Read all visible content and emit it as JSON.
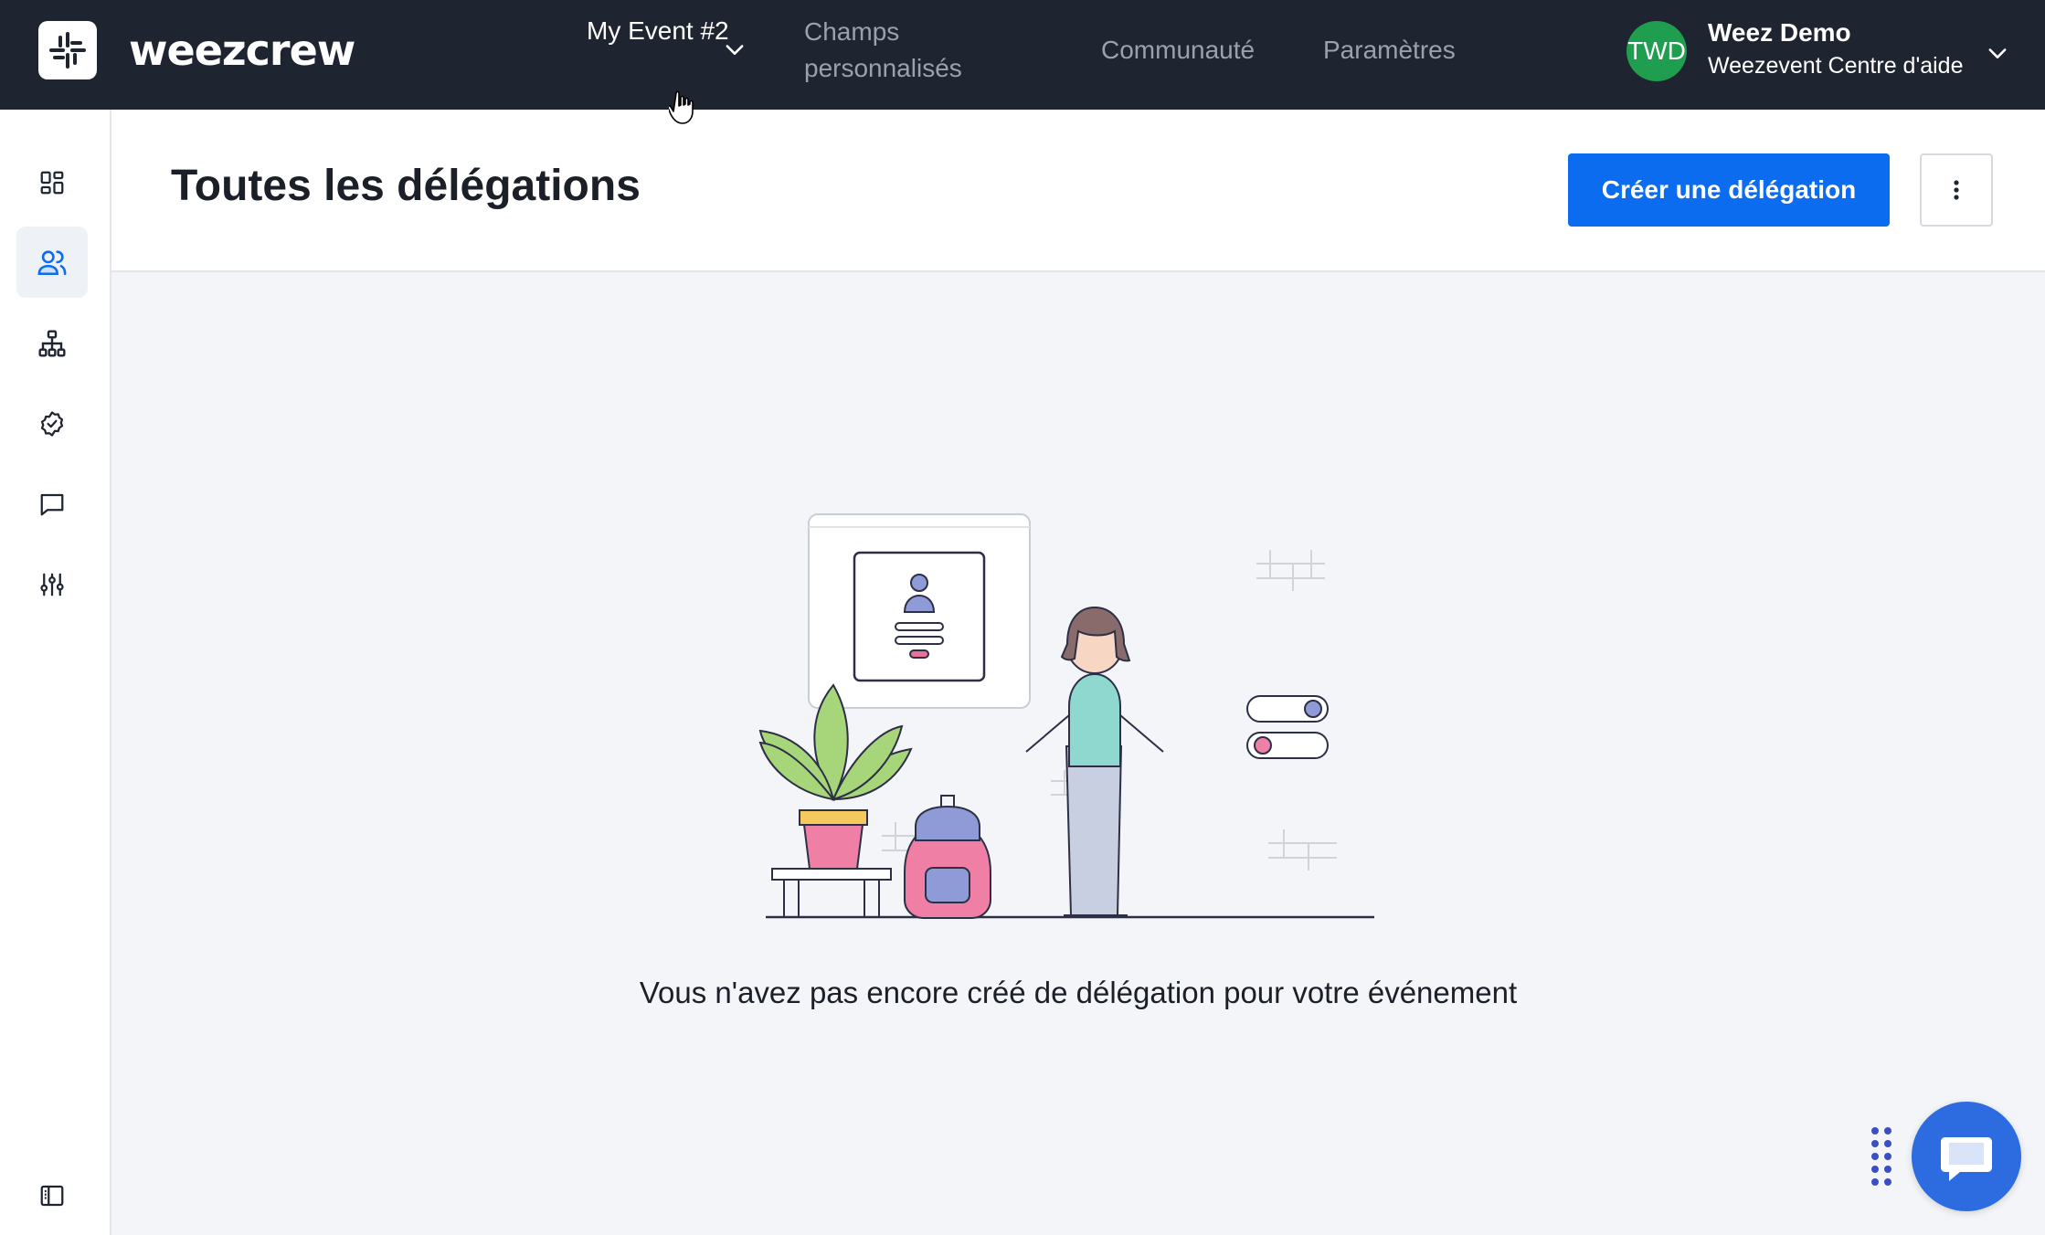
{
  "app": {
    "brand": "weezcrew"
  },
  "topbar": {
    "event_select": {
      "label": "My Event #2"
    },
    "nav": [
      {
        "label": "Champs personnalisés"
      },
      {
        "label": "Communauté"
      },
      {
        "label": "Paramètres"
      }
    ],
    "user": {
      "initials": "TWD",
      "name": "Weez Demo",
      "org": "Weezevent Centre d'aide"
    }
  },
  "sidebar": {
    "items": [
      {
        "icon": "dashboard-icon",
        "active": false
      },
      {
        "icon": "users-icon",
        "active": true
      },
      {
        "icon": "org-chart-icon",
        "active": false
      },
      {
        "icon": "check-badge-icon",
        "active": false
      },
      {
        "icon": "chat-bubble-icon",
        "active": false
      },
      {
        "icon": "sliders-icon",
        "active": false
      }
    ],
    "footer_icon": "panel-toggle-icon"
  },
  "header": {
    "title": "Toutes les délégations",
    "create_label": "Créer une délégation"
  },
  "empty_state": {
    "message": "Vous n'avez pas encore créé de délégation pour votre événement"
  },
  "colors": {
    "topbar": "#1f2530",
    "primary": "#0b6cf0",
    "avatar": "#1e9e4e",
    "chat": "#2d6be0"
  }
}
